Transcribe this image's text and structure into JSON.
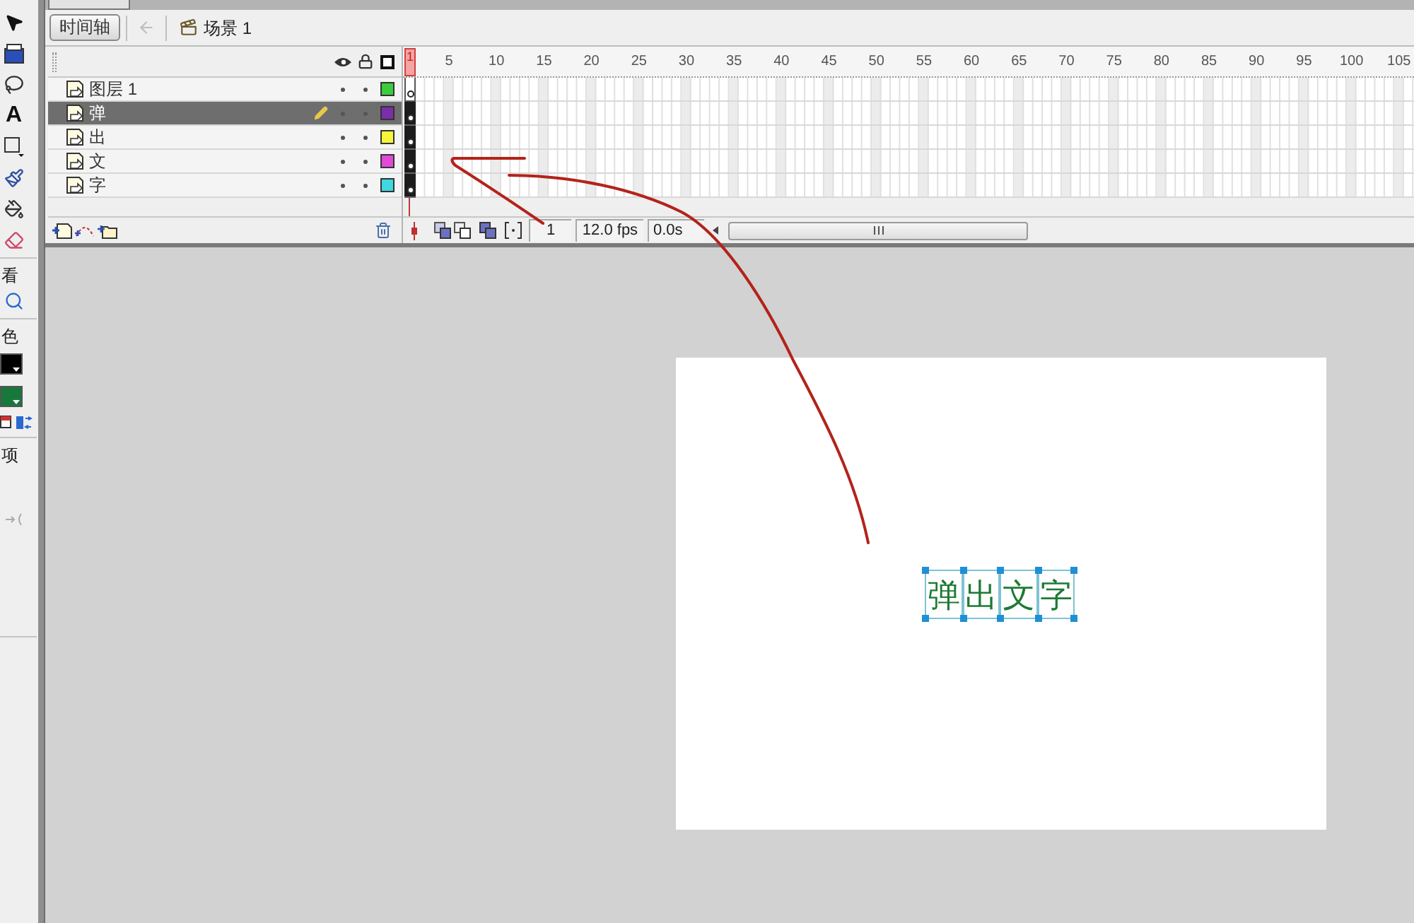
{
  "tools": {
    "text_tool": "A",
    "section_labels": [
      "看",
      "色",
      "项"
    ],
    "swatches": [
      {
        "color": "#000000"
      },
      {
        "color": "#16793a"
      }
    ]
  },
  "edit_bar": {
    "timeline_button": "时间轴",
    "back_disabled": true,
    "scene": "场景 1"
  },
  "timeline": {
    "playhead": "1",
    "ruler_ticks": [
      "5",
      "10",
      "15",
      "20",
      "25",
      "30",
      "35",
      "40",
      "45",
      "50",
      "55",
      "60",
      "65",
      "70",
      "75",
      "80",
      "85",
      "90",
      "95",
      "100",
      "105"
    ],
    "layers": [
      {
        "name": "图层 1",
        "selected": false,
        "visible": true,
        "locked": false,
        "color": "#3ccc3c",
        "has_content": false
      },
      {
        "name": "弹",
        "selected": true,
        "visible": true,
        "locked": false,
        "color": "#7a2ea8",
        "has_content": true
      },
      {
        "name": "出",
        "selected": false,
        "visible": true,
        "locked": false,
        "color": "#f5f53a",
        "has_content": true
      },
      {
        "name": "文",
        "selected": false,
        "visible": true,
        "locked": false,
        "color": "#e04ad8",
        "has_content": true
      },
      {
        "name": "字",
        "selected": false,
        "visible": true,
        "locked": false,
        "color": "#40d8e0",
        "has_content": true
      }
    ],
    "current_frame": "1",
    "frame_rate": "12.0 fps",
    "elapsed": "0.0s"
  },
  "stage": {
    "texts": [
      {
        "text": "弹",
        "selected": true
      },
      {
        "text": "出",
        "selected": true
      },
      {
        "text": "文",
        "selected": true
      },
      {
        "text": "字",
        "selected": true
      }
    ]
  }
}
